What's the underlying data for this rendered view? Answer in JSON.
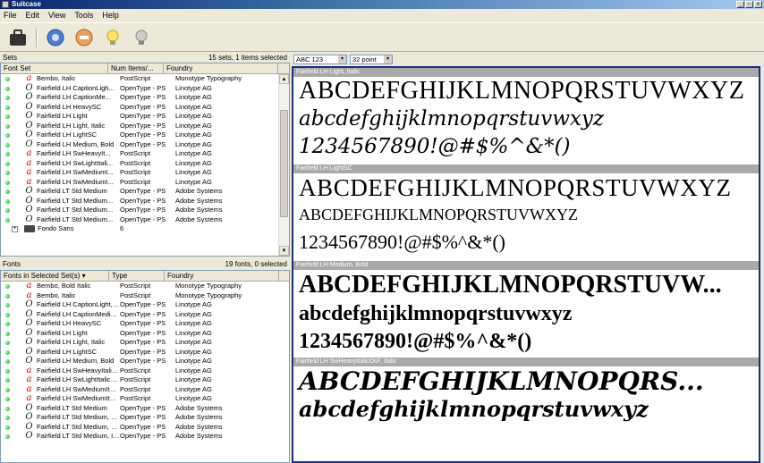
{
  "window": {
    "title": "Suitcase",
    "min": "_",
    "max": "▫",
    "close": "x"
  },
  "menu": [
    "File",
    "Edit",
    "View",
    "Tools",
    "Help"
  ],
  "sets": {
    "label": "Sets",
    "status": "15 sets,   1 items selected",
    "columns": [
      "Font Set",
      "Num Items/...",
      "Foundry"
    ],
    "rows": [
      {
        "kind": "ps",
        "name": "Bembo, Italic",
        "type": "PostScript",
        "foundry": "Monotype Typography"
      },
      {
        "kind": "ot",
        "name": "Fairfield LH CaptionLigh...",
        "type": "OpenType - PS",
        "foundry": "Linotype AG"
      },
      {
        "kind": "ot",
        "name": "Fairfield LH CaptionMe...",
        "type": "OpenType - PS",
        "foundry": "Linotype AG"
      },
      {
        "kind": "ot",
        "name": "Fairfield LH HeavySC",
        "type": "OpenType - PS",
        "foundry": "Linotype AG"
      },
      {
        "kind": "ot",
        "name": "Fairfield LH Light",
        "type": "OpenType - PS",
        "foundry": "Linotype AG"
      },
      {
        "kind": "ot",
        "name": "Fairfield LH Light, Italic",
        "type": "OpenType - PS",
        "foundry": "Linotype AG"
      },
      {
        "kind": "ot",
        "name": "Fairfield LH LightSC",
        "type": "OpenType - PS",
        "foundry": "Linotype AG"
      },
      {
        "kind": "ot",
        "name": "Fairfield LH Medium, Bold",
        "type": "OpenType - PS",
        "foundry": "Linotype AG"
      },
      {
        "kind": "ps",
        "name": "Fairfield LH SwHeavyIt...",
        "type": "PostScript",
        "foundry": "Linotype AG"
      },
      {
        "kind": "ps",
        "name": "Fairfield LH SwLightItali...",
        "type": "PostScript",
        "foundry": "Linotype AG"
      },
      {
        "kind": "ps",
        "name": "Fairfield LH SwMediumI...",
        "type": "PostScript",
        "foundry": "Linotype AG"
      },
      {
        "kind": "ps",
        "name": "Fairfield LH SwMediumI...",
        "type": "PostScript",
        "foundry": "Linotype AG"
      },
      {
        "kind": "ot",
        "name": "Fairfield LT Std Medium",
        "type": "OpenType - PS",
        "foundry": "Adobe Systems"
      },
      {
        "kind": "ot",
        "name": "Fairfield LT Std Medium...",
        "type": "OpenType - PS",
        "foundry": "Adobe Systems"
      },
      {
        "kind": "ot",
        "name": "Fairfield LT Std Medium...",
        "type": "OpenType - PS",
        "foundry": "Adobe Systems"
      },
      {
        "kind": "ot",
        "name": "Fairfield LT Std Medium...",
        "type": "OpenType - PS",
        "foundry": "Adobe Systems"
      }
    ],
    "group": {
      "expander": "+",
      "name": "Fondo Sans",
      "count": "6"
    }
  },
  "fonts": {
    "label": "Fonts",
    "status": "19 fonts,   0 selected",
    "columns": [
      "Fonts in Selected Set(s)",
      "Type",
      "Foundry"
    ],
    "rows": [
      {
        "kind": "ps",
        "name": "Bembo, Bold Italic",
        "type": "PostScript",
        "foundry": "Monotype Typography"
      },
      {
        "kind": "ps",
        "name": "Bembo, Italic",
        "type": "PostScript",
        "foundry": "Monotype Typography"
      },
      {
        "kind": "ot",
        "name": "Fairfield LH CaptionLight, It...",
        "type": "OpenType - PS",
        "foundry": "Linotype AG"
      },
      {
        "kind": "ot",
        "name": "Fairfield LH CaptionMedium...",
        "type": "OpenType - PS",
        "foundry": "Linotype AG"
      },
      {
        "kind": "ot",
        "name": "Fairfield LH HeavySC",
        "type": "OpenType - PS",
        "foundry": "Linotype AG"
      },
      {
        "kind": "ot",
        "name": "Fairfield LH Light",
        "type": "OpenType - PS",
        "foundry": "Linotype AG"
      },
      {
        "kind": "ot",
        "name": "Fairfield LH Light, Italic",
        "type": "OpenType - PS",
        "foundry": "Linotype AG"
      },
      {
        "kind": "ot",
        "name": "Fairfield LH LightSC",
        "type": "OpenType - PS",
        "foundry": "Linotype AG"
      },
      {
        "kind": "ot",
        "name": "Fairfield LH Medium, Bold",
        "type": "OpenType - PS",
        "foundry": "Linotype AG"
      },
      {
        "kind": "ps",
        "name": "Fairfield LH SwHeavyItalic...",
        "type": "PostScript",
        "foundry": "Linotype AG"
      },
      {
        "kind": "ps",
        "name": "Fairfield LH SwLightItalicOs...",
        "type": "PostScript",
        "foundry": "Linotype AG"
      },
      {
        "kind": "ps",
        "name": "Fairfield LH SwMediumItalic...",
        "type": "PostScript",
        "foundry": "Linotype AG"
      },
      {
        "kind": "ps",
        "name": "Fairfield LH SwMediumItalic...",
        "type": "PostScript",
        "foundry": "Linotype AG"
      },
      {
        "kind": "ot",
        "name": "Fairfield LT Std Medium",
        "type": "OpenType - PS",
        "foundry": "Adobe Systems"
      },
      {
        "kind": "ot",
        "name": "Fairfield LT Std Medium, Bold",
        "type": "OpenType - PS",
        "foundry": "Adobe Systems"
      },
      {
        "kind": "ot",
        "name": "Fairfield LT Std Medium, Bo...",
        "type": "OpenType - PS",
        "foundry": "Adobe Systems"
      },
      {
        "kind": "ot",
        "name": "Fairfield LT Std Medium, Italic",
        "type": "OpenType - PS",
        "foundry": "Adobe Systems"
      }
    ]
  },
  "preview": {
    "sample_value": "ABC 123",
    "size_value": "32 point",
    "blocks": [
      {
        "band": "Fairfield LH Light, Italic",
        "style": "light",
        "lines": [
          "ABCDEFGHIJKLMNOPQRSTUVWXYZ",
          "abcdefghijklmnopqrstuvwxyz",
          "1234567890!@#$%^&*()"
        ]
      },
      {
        "band": "Fairfield LH LightSC",
        "style": "sc",
        "lines": [
          "ABCDEFGHIJKLMNOPQRSTUVWXYZ",
          "ABCDEFGHIJKLMNOPQRSTUVWXYZ",
          "1234567890!@#$%^&*()"
        ]
      },
      {
        "band": "Fairfield LH Medium, Bold",
        "style": "bold",
        "lines": [
          "ABCDEFGHIJKLMNOPQRSTUVW...",
          "abcdefghijklmnopqrstuvwxyz",
          "1234567890!@#$%^&*()"
        ]
      },
      {
        "band": "Fairfield LH SwHeavyItalicOsF, Italic",
        "style": "swash",
        "lines": [
          "ABCDEFGHIJKLMNOPQRS...",
          "abcdefghijklmnopqrstuvwxyz"
        ]
      }
    ]
  },
  "colors": {
    "accent": "#1c2f8a",
    "postscript_glyph": "#d00000",
    "band": "#a9a9a9"
  }
}
